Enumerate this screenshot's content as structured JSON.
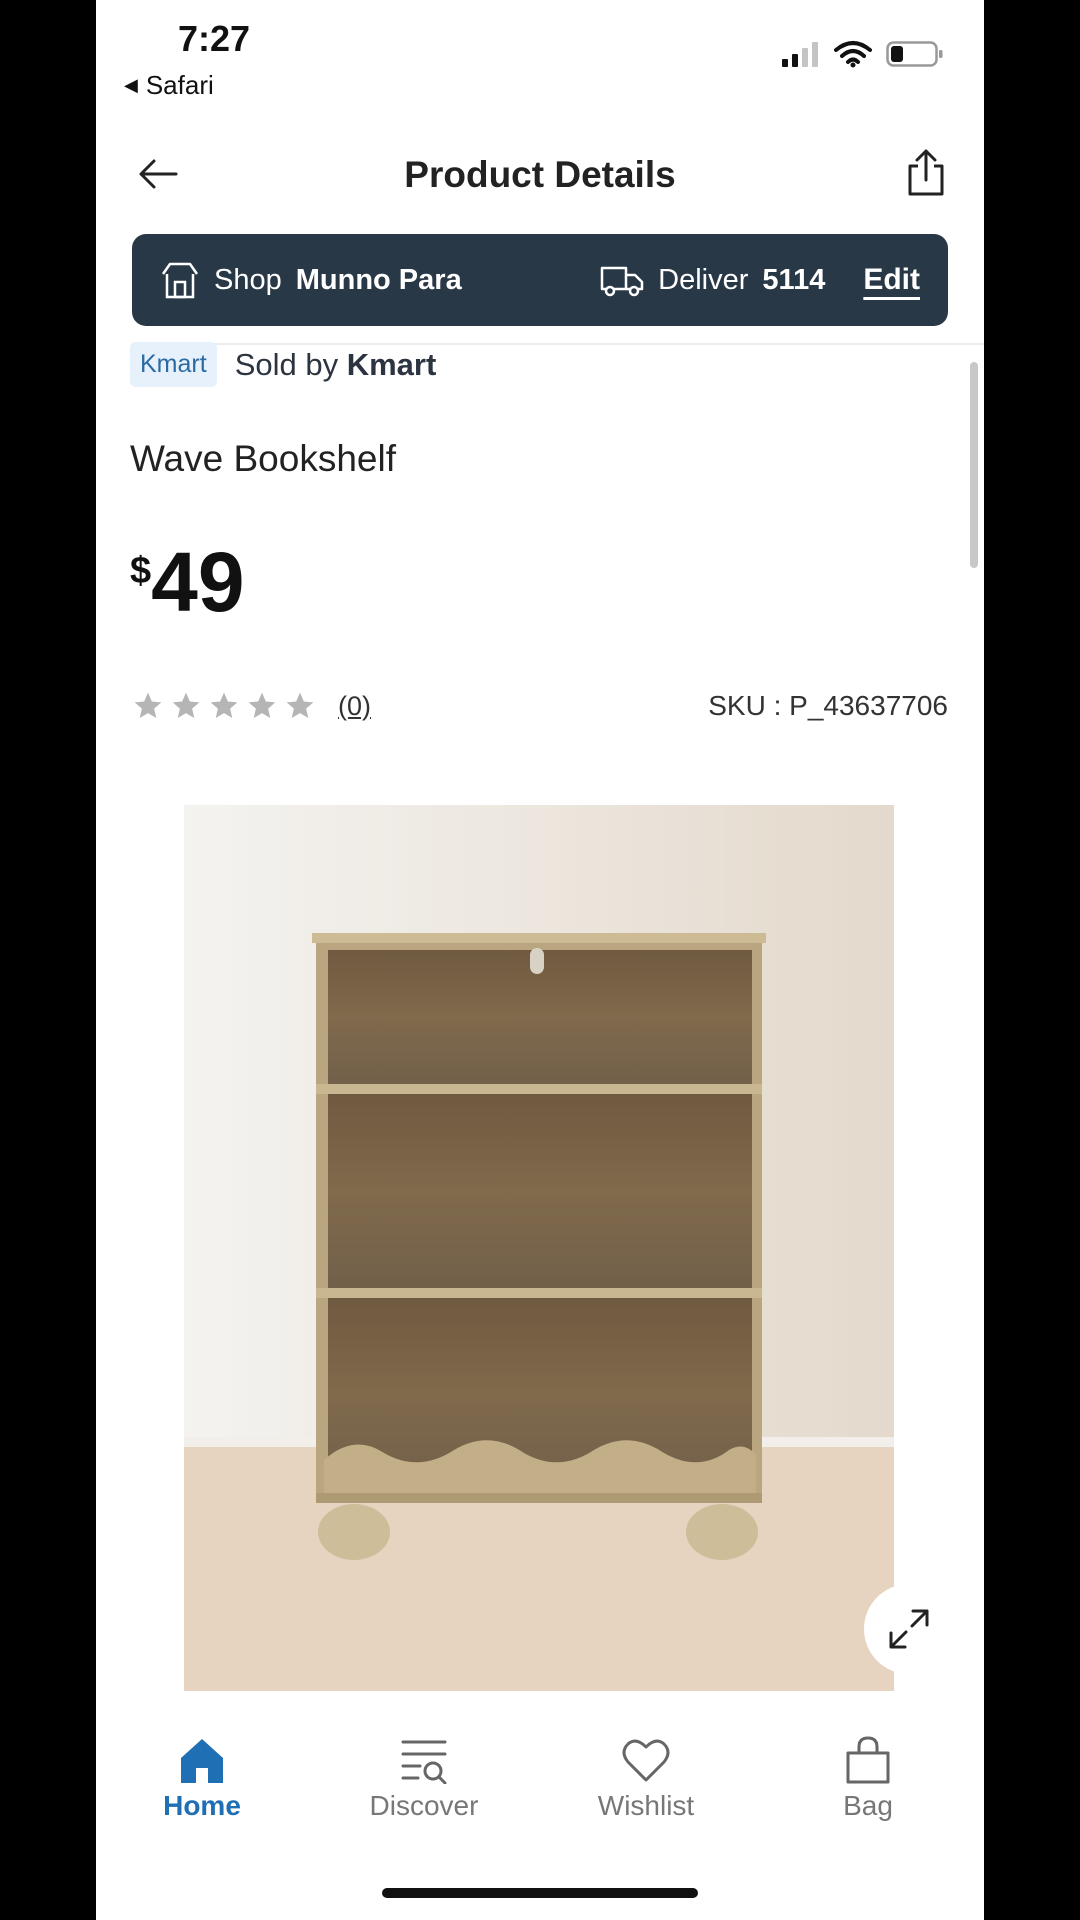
{
  "status_bar": {
    "time": "7:27",
    "back_app": "Safari"
  },
  "header": {
    "title": "Product Details"
  },
  "store_bar": {
    "shop_label": "Shop",
    "shop_name": "Munno Para",
    "deliver_label": "Deliver",
    "postcode": "5114",
    "edit_label": "Edit"
  },
  "seller": {
    "badge": "Kmart",
    "sold_by_label": "Sold by",
    "seller_name": "Kmart"
  },
  "product": {
    "name": "Wave Bookshelf",
    "currency": "$",
    "price": "49",
    "rating_stars": 0,
    "rating_max": 5,
    "review_count": "(0)",
    "sku": "SKU : P_43637706"
  },
  "bottom_nav": {
    "items": [
      {
        "label": "Home",
        "icon": "home-icon",
        "active": true
      },
      {
        "label": "Discover",
        "icon": "discover-icon",
        "active": false
      },
      {
        "label": "Wishlist",
        "icon": "heart-icon",
        "active": false
      },
      {
        "label": "Bag",
        "icon": "bag-icon",
        "active": false
      }
    ]
  },
  "colors": {
    "store_bar_bg": "#293847",
    "accent": "#1f6fb5",
    "badge_bg": "#e6f1fb"
  }
}
